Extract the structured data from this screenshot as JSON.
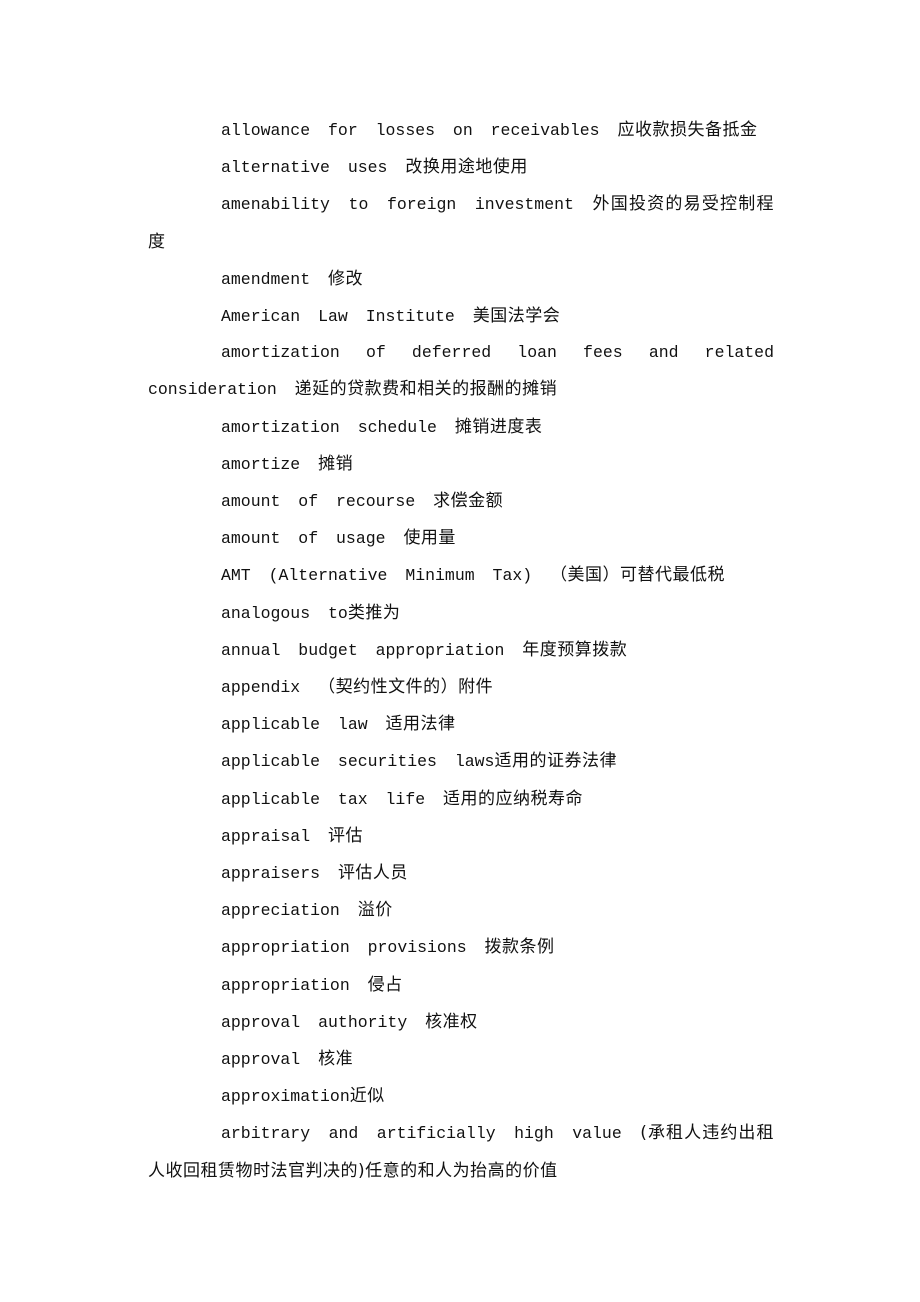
{
  "document": {
    "entries": [
      {
        "term": "allowance for losses on receivables",
        "sep": " ",
        "gloss": "应收款损失备抵金"
      },
      {
        "term": "alternative uses",
        "sep": " ",
        "gloss": "改换用途地使用"
      },
      {
        "term": "amenability to foreign investment",
        "sep": " ",
        "gloss": "外国投资的易受控制程度"
      },
      {
        "term": "amendment",
        "sep": " ",
        "gloss": "修改"
      },
      {
        "term": "American Law Institute",
        "sep": " ",
        "gloss": "美国法学会"
      },
      {
        "term": "amortization of deferred loan fees and related consideration",
        "sep": " ",
        "gloss": "递延的贷款费和相关的报酬的摊销"
      },
      {
        "term": "amortization schedule",
        "sep": " ",
        "gloss": "摊销进度表"
      },
      {
        "term": "amortize",
        "sep": " ",
        "gloss": "摊销"
      },
      {
        "term": "amount of recourse",
        "sep": " ",
        "gloss": "求偿金额"
      },
      {
        "term": "amount of usage",
        "sep": " ",
        "gloss": "使用量"
      },
      {
        "term": "AMT (Alternative Minimum Tax)",
        "sep": " ",
        "gloss": "（美国）可替代最低税"
      },
      {
        "term": "analogous to",
        "sep": "",
        "gloss": "类推为"
      },
      {
        "term": "annual budget appropriation",
        "sep": " ",
        "gloss": "年度预算拨款"
      },
      {
        "term": "appendix",
        "sep": " ",
        "gloss": "（契约性文件的）附件"
      },
      {
        "term": "applicable law",
        "sep": " ",
        "gloss": "适用法律"
      },
      {
        "term": "applicable securities laws",
        "sep": "",
        "gloss": "适用的证券法律"
      },
      {
        "term": "applicable tax life",
        "sep": " ",
        "gloss": "适用的应纳税寿命"
      },
      {
        "term": "appraisal",
        "sep": " ",
        "gloss": "评估"
      },
      {
        "term": "appraisers",
        "sep": " ",
        "gloss": "评估人员"
      },
      {
        "term": "appreciation",
        "sep": " ",
        "gloss": "溢价"
      },
      {
        "term": "appropriation provisions",
        "sep": " ",
        "gloss": "拨款条例"
      },
      {
        "term": "appropriation",
        "sep": " ",
        "gloss": "侵占"
      },
      {
        "term": "approval authority",
        "sep": " ",
        "gloss": "核准权"
      },
      {
        "term": "approval",
        "sep": " ",
        "gloss": "核准"
      },
      {
        "term": "approximation",
        "sep": "",
        "gloss": "近似"
      },
      {
        "term": "arbitrary and artificially high value",
        "sep": " ",
        "gloss": "(承租人违约出租人收回租赁物时法官判决的)任意的和人为抬高的价值"
      }
    ]
  }
}
